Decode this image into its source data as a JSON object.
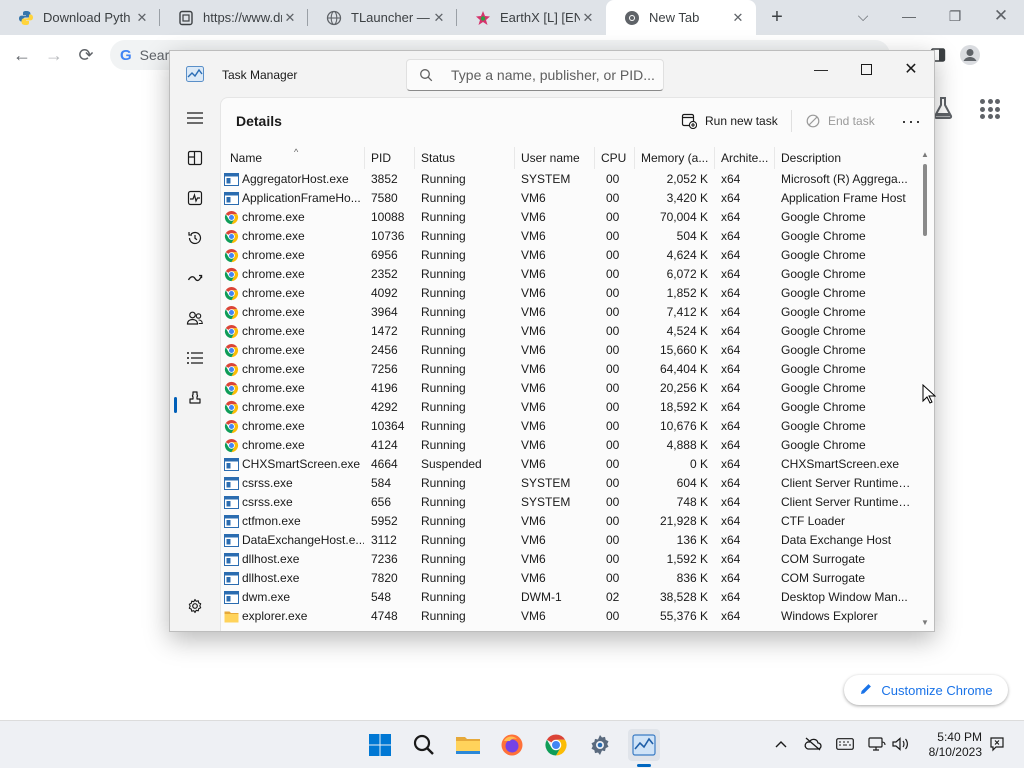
{
  "browser": {
    "tabs": [
      {
        "title": "Download Pyth",
        "icon": "python-icon"
      },
      {
        "title": "https://www.dr",
        "icon": "page-icon"
      },
      {
        "title": "TLauncher — D",
        "icon": "globe-icon"
      },
      {
        "title": "EarthX [L] [ENG",
        "icon": "earthx-icon"
      },
      {
        "title": "New Tab",
        "icon": "chrome-icon",
        "active": true
      }
    ],
    "omnibox_placeholder": "Sear",
    "customize_label": "Customize Chrome"
  },
  "task_manager": {
    "window_title": "Task Manager",
    "search_placeholder": "Type a name, publisher, or PID...",
    "page_title": "Details",
    "run_new_task_label": "Run new task",
    "end_task_label": "End task",
    "columns": [
      "Name",
      "PID",
      "Status",
      "User name",
      "CPU",
      "Memory (a...",
      "Archite...",
      "Description"
    ],
    "sidebar_icons": [
      "menu-icon",
      "processes-icon",
      "performance-icon",
      "app-history-icon",
      "startup-apps-icon",
      "users-icon",
      "details-icon",
      "services-icon",
      "settings-icon"
    ],
    "rows": [
      {
        "name": "AggregatorHost.exe",
        "icon": "app",
        "pid": "3852",
        "status": "Running",
        "user": "SYSTEM",
        "cpu": "00",
        "mem": "2,052 K",
        "arch": "x64",
        "desc": "Microsoft (R) Aggrega..."
      },
      {
        "name": "ApplicationFrameHo...",
        "icon": "app",
        "pid": "7580",
        "status": "Running",
        "user": "VM6",
        "cpu": "00",
        "mem": "3,420 K",
        "arch": "x64",
        "desc": "Application Frame Host"
      },
      {
        "name": "chrome.exe",
        "icon": "chrome",
        "pid": "10088",
        "status": "Running",
        "user": "VM6",
        "cpu": "00",
        "mem": "70,004 K",
        "arch": "x64",
        "desc": "Google Chrome"
      },
      {
        "name": "chrome.exe",
        "icon": "chrome",
        "pid": "10736",
        "status": "Running",
        "user": "VM6",
        "cpu": "00",
        "mem": "504 K",
        "arch": "x64",
        "desc": "Google Chrome"
      },
      {
        "name": "chrome.exe",
        "icon": "chrome",
        "pid": "6956",
        "status": "Running",
        "user": "VM6",
        "cpu": "00",
        "mem": "4,624 K",
        "arch": "x64",
        "desc": "Google Chrome"
      },
      {
        "name": "chrome.exe",
        "icon": "chrome",
        "pid": "2352",
        "status": "Running",
        "user": "VM6",
        "cpu": "00",
        "mem": "6,072 K",
        "arch": "x64",
        "desc": "Google Chrome"
      },
      {
        "name": "chrome.exe",
        "icon": "chrome",
        "pid": "4092",
        "status": "Running",
        "user": "VM6",
        "cpu": "00",
        "mem": "1,852 K",
        "arch": "x64",
        "desc": "Google Chrome"
      },
      {
        "name": "chrome.exe",
        "icon": "chrome",
        "pid": "3964",
        "status": "Running",
        "user": "VM6",
        "cpu": "00",
        "mem": "7,412 K",
        "arch": "x64",
        "desc": "Google Chrome"
      },
      {
        "name": "chrome.exe",
        "icon": "chrome",
        "pid": "1472",
        "status": "Running",
        "user": "VM6",
        "cpu": "00",
        "mem": "4,524 K",
        "arch": "x64",
        "desc": "Google Chrome"
      },
      {
        "name": "chrome.exe",
        "icon": "chrome",
        "pid": "2456",
        "status": "Running",
        "user": "VM6",
        "cpu": "00",
        "mem": "15,660 K",
        "arch": "x64",
        "desc": "Google Chrome"
      },
      {
        "name": "chrome.exe",
        "icon": "chrome",
        "pid": "7256",
        "status": "Running",
        "user": "VM6",
        "cpu": "00",
        "mem": "64,404 K",
        "arch": "x64",
        "desc": "Google Chrome"
      },
      {
        "name": "chrome.exe",
        "icon": "chrome",
        "pid": "4196",
        "status": "Running",
        "user": "VM6",
        "cpu": "00",
        "mem": "20,256 K",
        "arch": "x64",
        "desc": "Google Chrome"
      },
      {
        "name": "chrome.exe",
        "icon": "chrome",
        "pid": "4292",
        "status": "Running",
        "user": "VM6",
        "cpu": "00",
        "mem": "18,592 K",
        "arch": "x64",
        "desc": "Google Chrome"
      },
      {
        "name": "chrome.exe",
        "icon": "chrome",
        "pid": "10364",
        "status": "Running",
        "user": "VM6",
        "cpu": "00",
        "mem": "10,676 K",
        "arch": "x64",
        "desc": "Google Chrome"
      },
      {
        "name": "chrome.exe",
        "icon": "chrome",
        "pid": "4124",
        "status": "Running",
        "user": "VM6",
        "cpu": "00",
        "mem": "4,888 K",
        "arch": "x64",
        "desc": "Google Chrome"
      },
      {
        "name": "CHXSmartScreen.exe",
        "icon": "app",
        "pid": "4664",
        "status": "Suspended",
        "user": "VM6",
        "cpu": "00",
        "mem": "0 K",
        "arch": "x64",
        "desc": "CHXSmartScreen.exe"
      },
      {
        "name": "csrss.exe",
        "icon": "app",
        "pid": "584",
        "status": "Running",
        "user": "SYSTEM",
        "cpu": "00",
        "mem": "604 K",
        "arch": "x64",
        "desc": "Client Server Runtime ..."
      },
      {
        "name": "csrss.exe",
        "icon": "app",
        "pid": "656",
        "status": "Running",
        "user": "SYSTEM",
        "cpu": "00",
        "mem": "748 K",
        "arch": "x64",
        "desc": "Client Server Runtime ..."
      },
      {
        "name": "ctfmon.exe",
        "icon": "app",
        "pid": "5952",
        "status": "Running",
        "user": "VM6",
        "cpu": "00",
        "mem": "21,928 K",
        "arch": "x64",
        "desc": "CTF Loader"
      },
      {
        "name": "DataExchangeHost.e...",
        "icon": "app",
        "pid": "3112",
        "status": "Running",
        "user": "VM6",
        "cpu": "00",
        "mem": "136 K",
        "arch": "x64",
        "desc": "Data Exchange Host"
      },
      {
        "name": "dllhost.exe",
        "icon": "app",
        "pid": "7236",
        "status": "Running",
        "user": "VM6",
        "cpu": "00",
        "mem": "1,592 K",
        "arch": "x64",
        "desc": "COM Surrogate"
      },
      {
        "name": "dllhost.exe",
        "icon": "app",
        "pid": "7820",
        "status": "Running",
        "user": "VM6",
        "cpu": "00",
        "mem": "836 K",
        "arch": "x64",
        "desc": "COM Surrogate"
      },
      {
        "name": "dwm.exe",
        "icon": "app",
        "pid": "548",
        "status": "Running",
        "user": "DWM-1",
        "cpu": "02",
        "mem": "38,528 K",
        "arch": "x64",
        "desc": "Desktop Window Man..."
      },
      {
        "name": "explorer.exe",
        "icon": "folder",
        "pid": "4748",
        "status": "Running",
        "user": "VM6",
        "cpu": "00",
        "mem": "55,376 K",
        "arch": "x64",
        "desc": "Windows Explorer"
      }
    ]
  },
  "taskbar": {
    "apps": [
      "windows-start-icon",
      "search-icon",
      "file-explorer-icon",
      "firefox-icon",
      "chrome-icon",
      "settings-icon",
      "task-manager-icon"
    ],
    "time": "5:40 PM",
    "date": "8/10/2023"
  },
  "colors": {
    "accent": "#005fb8",
    "chrome_blue": "#1a73e8",
    "tab_strip": "#dfe3e8"
  }
}
